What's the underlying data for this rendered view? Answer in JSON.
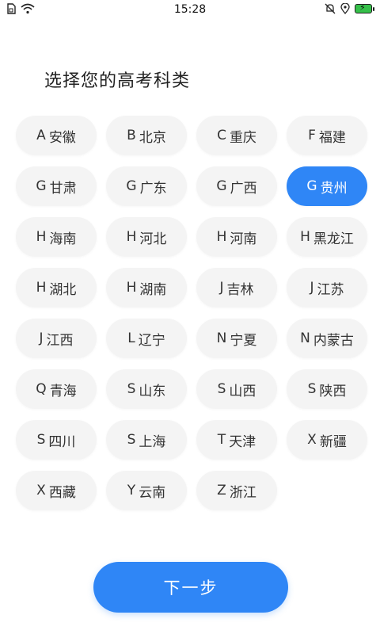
{
  "status_bar": {
    "time": "15:28"
  },
  "title": "选择您的高考科类",
  "accent_color": "#2f86f6",
  "provinces": [
    {
      "letter": "A",
      "name": "安徽",
      "selected": false
    },
    {
      "letter": "B",
      "name": "北京",
      "selected": false
    },
    {
      "letter": "C",
      "name": "重庆",
      "selected": false
    },
    {
      "letter": "F",
      "name": "福建",
      "selected": false
    },
    {
      "letter": "G",
      "name": "甘肃",
      "selected": false
    },
    {
      "letter": "G",
      "name": "广东",
      "selected": false
    },
    {
      "letter": "G",
      "name": "广西",
      "selected": false
    },
    {
      "letter": "G",
      "name": "贵州",
      "selected": true
    },
    {
      "letter": "H",
      "name": "海南",
      "selected": false
    },
    {
      "letter": "H",
      "name": "河北",
      "selected": false
    },
    {
      "letter": "H",
      "name": "河南",
      "selected": false
    },
    {
      "letter": "H",
      "name": "黑龙江",
      "selected": false
    },
    {
      "letter": "H",
      "name": "湖北",
      "selected": false
    },
    {
      "letter": "H",
      "name": "湖南",
      "selected": false
    },
    {
      "letter": "J",
      "name": "吉林",
      "selected": false
    },
    {
      "letter": "J",
      "name": "江苏",
      "selected": false
    },
    {
      "letter": "J",
      "name": "江西",
      "selected": false
    },
    {
      "letter": "L",
      "name": "辽宁",
      "selected": false
    },
    {
      "letter": "N",
      "name": "宁夏",
      "selected": false
    },
    {
      "letter": "N",
      "name": "内蒙古",
      "selected": false
    },
    {
      "letter": "Q",
      "name": "青海",
      "selected": false
    },
    {
      "letter": "S",
      "name": "山东",
      "selected": false
    },
    {
      "letter": "S",
      "name": "山西",
      "selected": false
    },
    {
      "letter": "S",
      "name": "陕西",
      "selected": false
    },
    {
      "letter": "S",
      "name": "四川",
      "selected": false
    },
    {
      "letter": "S",
      "name": "上海",
      "selected": false
    },
    {
      "letter": "T",
      "name": "天津",
      "selected": false
    },
    {
      "letter": "X",
      "name": "新疆",
      "selected": false
    },
    {
      "letter": "X",
      "name": "西藏",
      "selected": false
    },
    {
      "letter": "Y",
      "name": "云南",
      "selected": false
    },
    {
      "letter": "Z",
      "name": "浙江",
      "selected": false
    }
  ],
  "next_button_label": "下一步"
}
